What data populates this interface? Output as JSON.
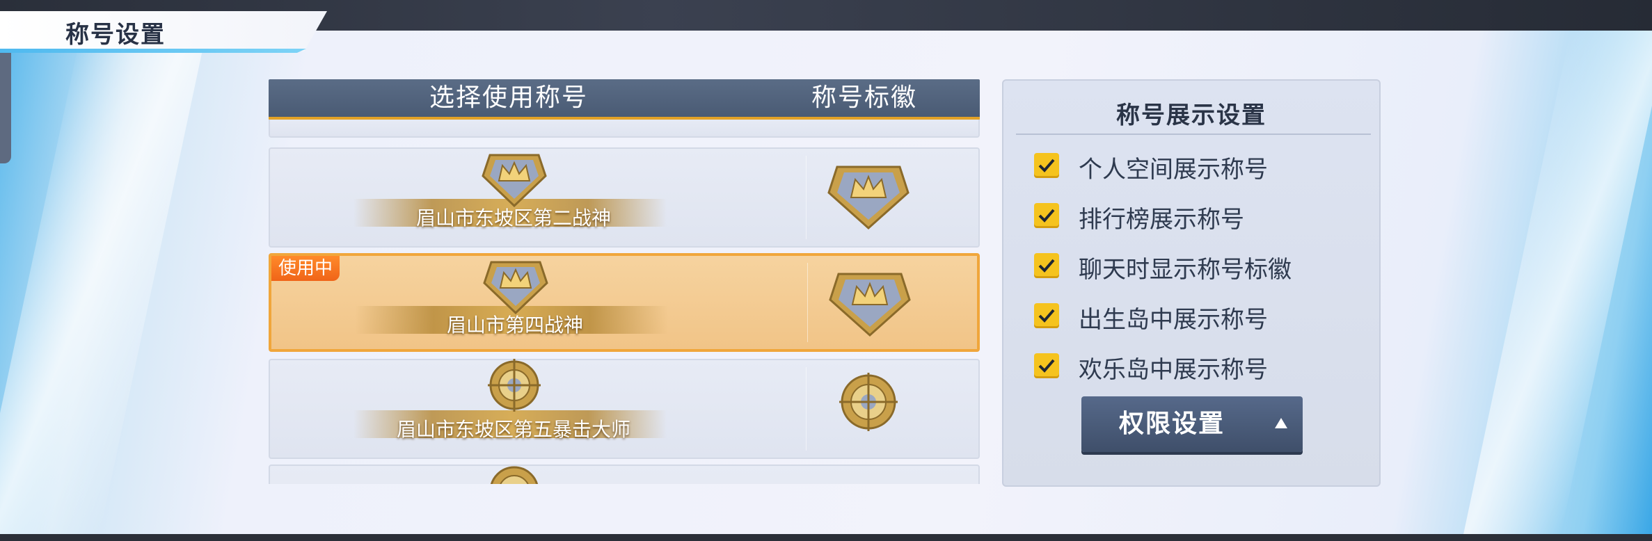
{
  "screen_title": "称号设置",
  "list": {
    "header_left": "选择使用称号",
    "header_right": "称号标徽",
    "rows": [
      {
        "title": "眉山市东坡区第二战神",
        "badge": "crown-badge-icon",
        "in_use": false
      },
      {
        "title": "眉山市第四战神",
        "badge": "crown-badge-icon",
        "in_use": true,
        "in_use_label": "使用中"
      },
      {
        "title": "眉山市东坡区第五暴击大师",
        "badge": "target-badge-icon",
        "in_use": false
      }
    ]
  },
  "settings": {
    "title": "称号展示设置",
    "options": [
      {
        "label": "个人空间展示称号",
        "checked": true
      },
      {
        "label": "排行榜展示称号",
        "checked": true
      },
      {
        "label": "聊天时显示称号标徽",
        "checked": true
      },
      {
        "label": "出生岛中展示称号",
        "checked": true
      },
      {
        "label": "欢乐岛中展示称号",
        "checked": true
      }
    ],
    "permission_button": "权限设置"
  },
  "colors": {
    "accent_yellow": "#f5c31e",
    "active_row": "#f1c487",
    "active_border": "#f0a63b",
    "header_bg": "#4a5b74",
    "in_use_tag": "#f06418"
  }
}
